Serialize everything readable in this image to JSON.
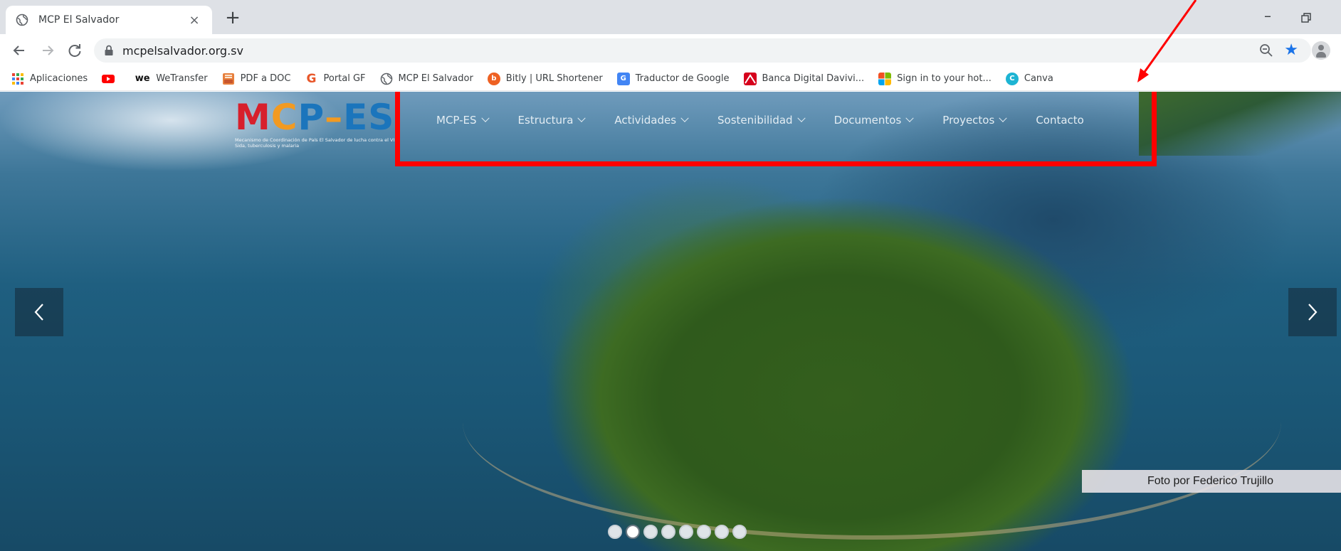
{
  "browser": {
    "tab": {
      "title": "MCP El Salvador",
      "close_glyph": "×"
    },
    "new_tab_glyph": "+",
    "window": {
      "minimize_glyph": "–"
    },
    "url": "mcpelsalvador.org.sv"
  },
  "bookmarks": [
    {
      "label": "Aplicaciones",
      "icon": "apps-grid-icon"
    },
    {
      "label": "",
      "icon": "youtube-icon"
    },
    {
      "label": "WeTransfer",
      "icon": "wetransfer-icon",
      "glyph": "we"
    },
    {
      "label": "PDF a DOC",
      "icon": "pdf-doc-icon"
    },
    {
      "label": "Portal GF",
      "icon": "portal-gf-icon",
      "glyph": "G"
    },
    {
      "label": "MCP El Salvador",
      "icon": "globe-icon"
    },
    {
      "label": "Bitly | URL Shortener",
      "icon": "bitly-icon",
      "glyph": "b"
    },
    {
      "label": "Traductor de Google",
      "icon": "google-translate-icon",
      "glyph": "G"
    },
    {
      "label": "Banca Digital Davivi...",
      "icon": "davivienda-icon"
    },
    {
      "label": "Sign in to your hot...",
      "icon": "microsoft-icon"
    },
    {
      "label": "Canva",
      "icon": "canva-icon",
      "glyph": "C"
    }
  ],
  "site": {
    "logo": {
      "m": "M",
      "c": "C",
      "p": "P",
      "dash": "–",
      "es": "ES",
      "tagline": "Mecanismo de Coordinación de País El Salvador de lucha contra el VIH Sida, tuberculosis y malaria"
    },
    "nav": [
      {
        "label": "MCP-ES",
        "has_dropdown": true
      },
      {
        "label": "Estructura",
        "has_dropdown": true
      },
      {
        "label": "Actividades",
        "has_dropdown": true
      },
      {
        "label": "Sostenibilidad",
        "has_dropdown": true
      },
      {
        "label": "Documentos",
        "has_dropdown": true
      },
      {
        "label": "Proyectos",
        "has_dropdown": true
      },
      {
        "label": "Contacto",
        "has_dropdown": false
      }
    ],
    "slider": {
      "caption": "Foto por Federico Trujillo",
      "dot_count": 8,
      "active_dot": 1
    }
  },
  "colors": {
    "annotation": "#ff0000",
    "logo_red": "#d7202c",
    "logo_orange": "#f29a21",
    "logo_blue": "#1b75bc",
    "bookmark_star": "#1a73e8"
  }
}
